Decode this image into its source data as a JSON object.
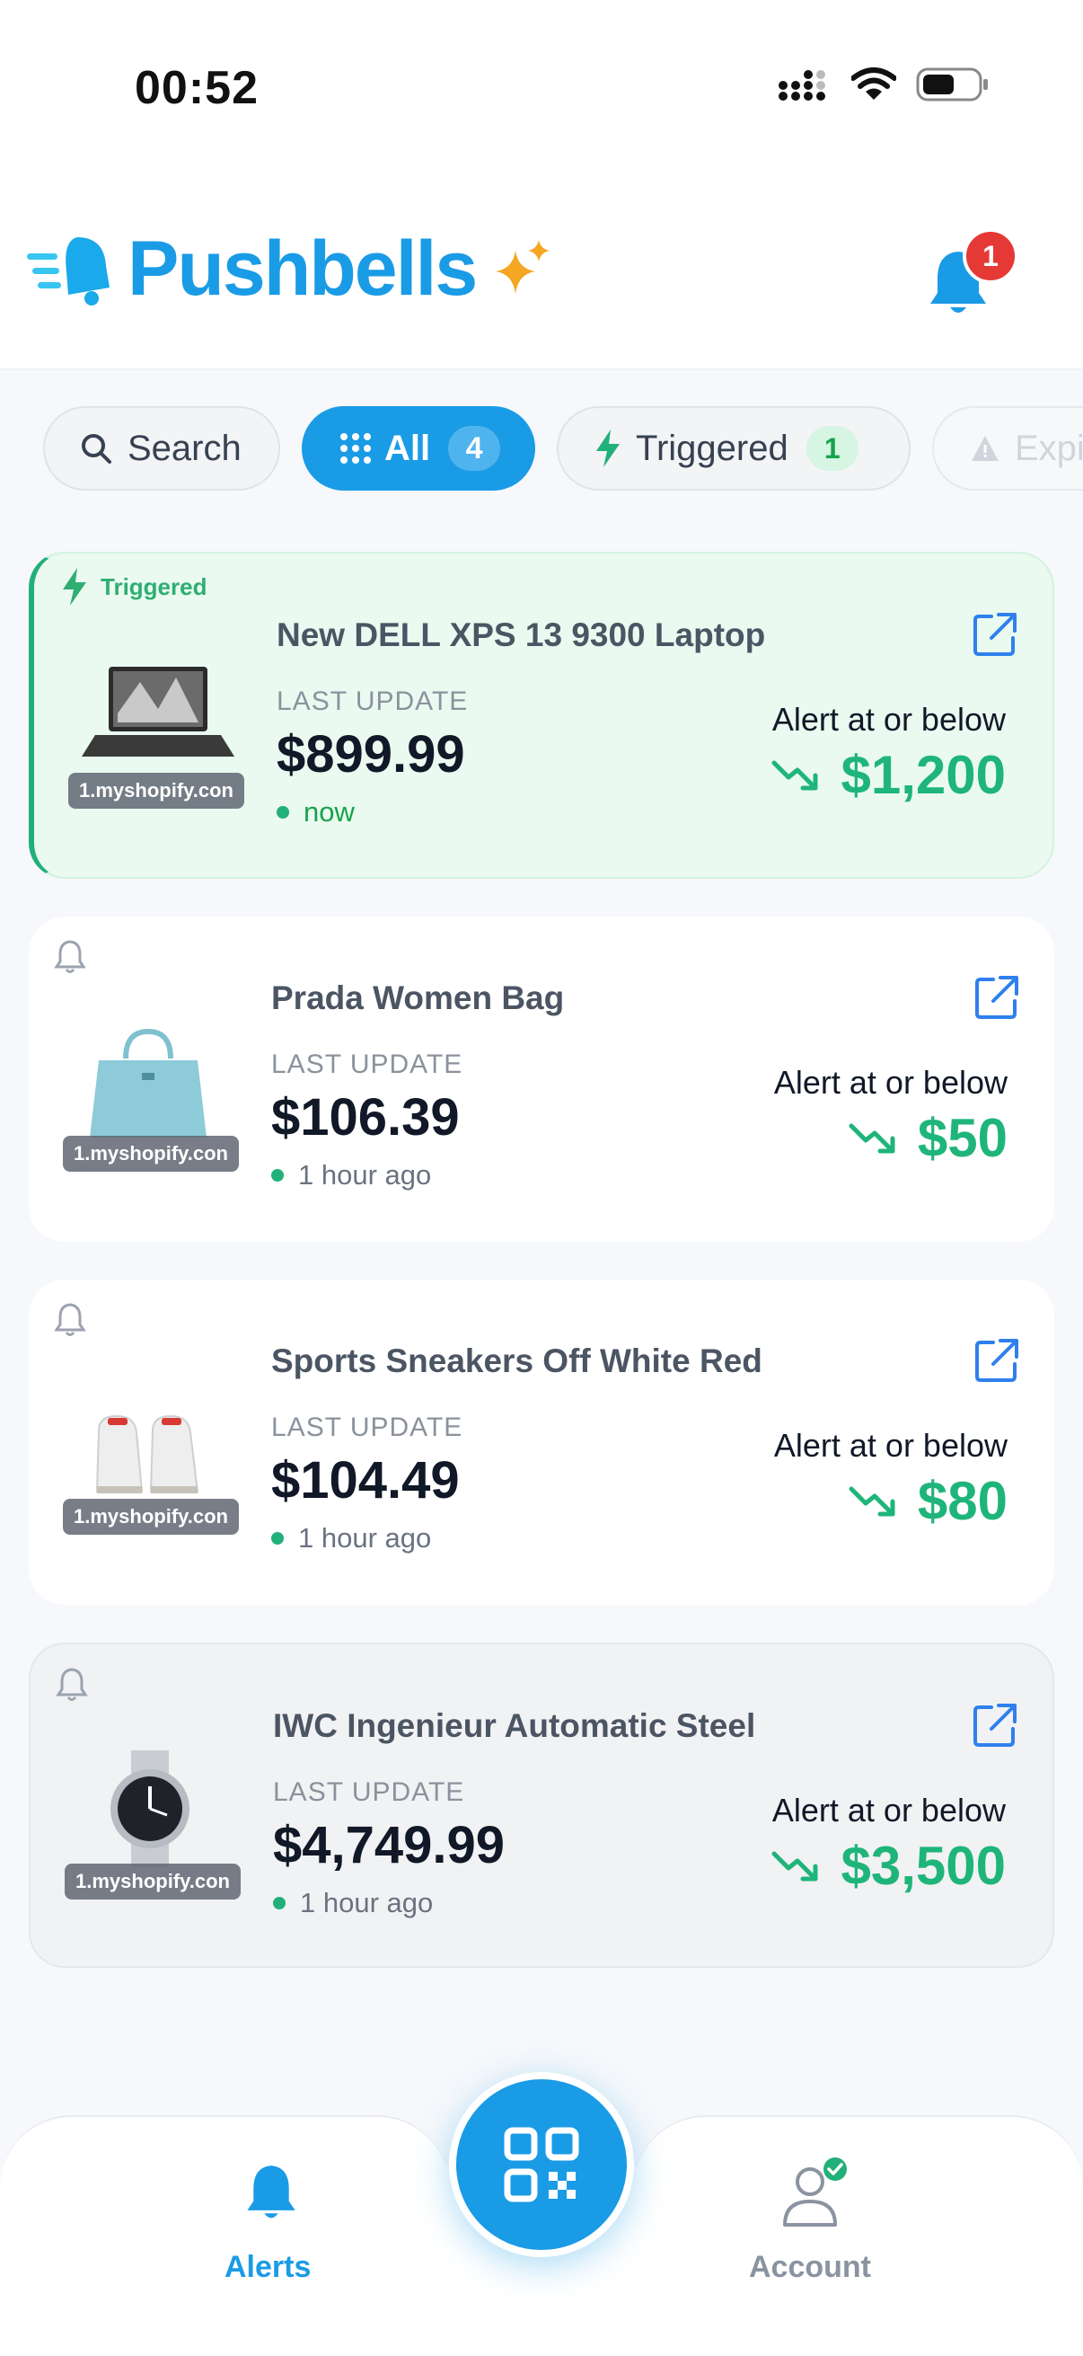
{
  "status_bar": {
    "time": "00:52"
  },
  "header": {
    "app_name": "Pushbells",
    "notification_count": "1"
  },
  "filters": {
    "search_label": "Search",
    "all_label": "All",
    "all_count": "4",
    "triggered_label": "Triggered",
    "triggered_count": "1",
    "expired_label": "Expi"
  },
  "alerts": [
    {
      "tag": "Triggered",
      "title": "New DELL XPS 13 9300 Laptop",
      "last_update_label": "LAST UPDATE",
      "price": "$899.99",
      "time": "now",
      "alert_label": "Alert at or below",
      "alert_value": "$1,200",
      "shop": "1.myshopify.con"
    },
    {
      "title": "Prada Women Bag",
      "last_update_label": "LAST UPDATE",
      "price": "$106.39",
      "time": "1 hour ago",
      "alert_label": "Alert at or below",
      "alert_value": "$50",
      "shop": "1.myshopify.con"
    },
    {
      "title": "Sports Sneakers Off White Red",
      "last_update_label": "LAST UPDATE",
      "price": "$104.49",
      "time": "1 hour ago",
      "alert_label": "Alert at or below",
      "alert_value": "$80",
      "shop": "1.myshopify.con"
    },
    {
      "title": "IWC Ingenieur Automatic Steel",
      "last_update_label": "LAST UPDATE",
      "price": "$4,749.99",
      "time": "1 hour ago",
      "alert_label": "Alert at or below",
      "alert_value": "$3,500",
      "shop": "1.myshopify.con"
    }
  ],
  "nav": {
    "alerts_label": "Alerts",
    "account_label": "Account"
  },
  "colors": {
    "brand": "#1a9be6",
    "success": "#1fb57a",
    "badge": "#e53935",
    "sparkle": "#f5a623"
  },
  "icons": [
    "signal-icon",
    "wifi-icon",
    "battery-icon",
    "logo-bell-icon",
    "sparkle-icon",
    "bell-icon",
    "search-icon",
    "grid-icon",
    "bolt-icon",
    "warning-icon",
    "external-link-icon",
    "trend-down-icon",
    "qr-code-icon",
    "account-icon"
  ]
}
